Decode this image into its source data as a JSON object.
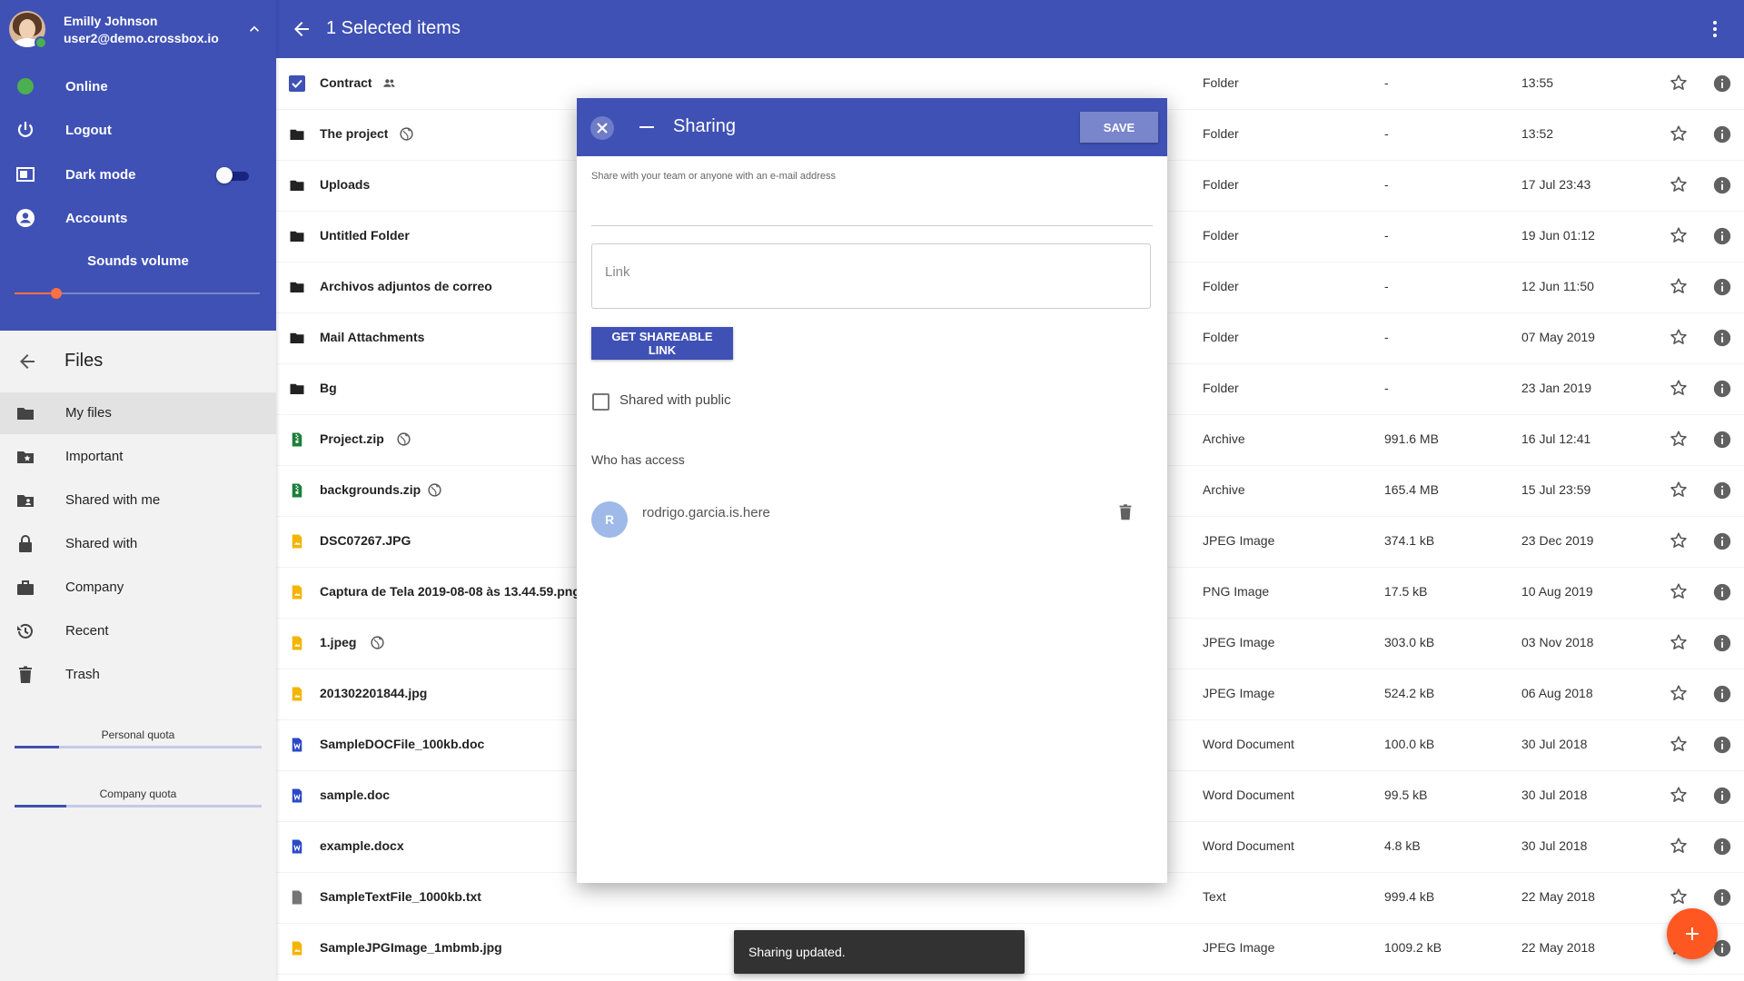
{
  "user": {
    "name": "Emilly Johnson",
    "email": "user2@demo.crossbox.io",
    "status": "Online"
  },
  "sidebar": {
    "menu": [
      {
        "label": "Online",
        "icon": "status-dot-icon"
      },
      {
        "label": "Logout",
        "icon": "power-icon"
      },
      {
        "label": "Dark mode",
        "icon": "dark-mode-icon"
      },
      {
        "label": "Accounts",
        "icon": "account-circle-icon"
      }
    ],
    "dark_mode_on": false,
    "sounds_label": "Sounds volume",
    "sounds_volume": 0.17,
    "files_title": "Files",
    "nav": [
      {
        "label": "My files",
        "icon": "folder-icon",
        "active": true
      },
      {
        "label": "Important",
        "icon": "folder-star-icon",
        "active": false
      },
      {
        "label": "Shared with me",
        "icon": "folder-shared-icon",
        "active": false
      },
      {
        "label": "Shared with",
        "icon": "lock-icon",
        "active": false
      },
      {
        "label": "Company",
        "icon": "briefcase-icon",
        "active": false
      },
      {
        "label": "Recent",
        "icon": "history-icon",
        "active": false
      },
      {
        "label": "Trash",
        "icon": "trash-icon",
        "active": false
      }
    ],
    "quotas": [
      {
        "label": "Personal quota",
        "fraction": 0.18
      },
      {
        "label": "Company quota",
        "fraction": 0.21
      }
    ]
  },
  "topbar": {
    "title": "1 Selected items"
  },
  "files": [
    {
      "name": "Contract",
      "icon": "checkbox-checked-icon",
      "badge": "people-icon",
      "type": "Folder",
      "size": "-",
      "date": "13:55"
    },
    {
      "name": "The project",
      "icon": "folder-icon",
      "badge": "globe-icon",
      "type": "Folder",
      "size": "-",
      "date": "13:52"
    },
    {
      "name": "Uploads",
      "icon": "folder-icon",
      "badge": "",
      "type": "Folder",
      "size": "-",
      "date": "17 Jul 23:43"
    },
    {
      "name": "Untitled Folder",
      "icon": "folder-icon",
      "badge": "",
      "type": "Folder",
      "size": "-",
      "date": "19 Jun 01:12"
    },
    {
      "name": "Archivos adjuntos de correo",
      "icon": "folder-icon",
      "badge": "",
      "type": "Folder",
      "size": "-",
      "date": "12 Jun 11:50"
    },
    {
      "name": "Mail Attachments",
      "icon": "folder-icon",
      "badge": "",
      "type": "Folder",
      "size": "-",
      "date": "07 May 2019"
    },
    {
      "name": "Bg",
      "icon": "folder-icon",
      "badge": "",
      "type": "Folder",
      "size": "-",
      "date": "23 Jan 2019"
    },
    {
      "name": "Project.zip",
      "icon": "archive-icon",
      "badge": "globe-icon",
      "type": "Archive",
      "size": "991.6 MB",
      "date": "16 Jul 12:41"
    },
    {
      "name": "backgrounds.zip",
      "icon": "archive-icon",
      "badge": "globe-icon",
      "type": "Archive",
      "size": "165.4 MB",
      "date": "15 Jul 23:59"
    },
    {
      "name": "DSC07267.JPG",
      "icon": "image-file-icon",
      "badge": "",
      "type": "JPEG Image",
      "size": "374.1 kB",
      "date": "23 Dec 2019"
    },
    {
      "name": "Captura de Tela 2019-08-08 às 13.44.59.png",
      "icon": "image-file-icon",
      "badge": "",
      "type": "PNG Image",
      "size": "17.5 kB",
      "date": "10 Aug 2019"
    },
    {
      "name": "1.jpeg",
      "icon": "image-file-icon",
      "badge": "globe-icon",
      "type": "JPEG Image",
      "size": "303.0 kB",
      "date": "03 Nov 2018"
    },
    {
      "name": "201302201844.jpg",
      "icon": "image-file-icon",
      "badge": "",
      "type": "JPEG Image",
      "size": "524.2 kB",
      "date": "06 Aug 2018"
    },
    {
      "name": "SampleDOCFile_100kb.doc",
      "icon": "word-file-icon",
      "badge": "",
      "type": "Word Document",
      "size": "100.0 kB",
      "date": "30 Jul 2018"
    },
    {
      "name": "sample.doc",
      "icon": "word-file-icon",
      "badge": "",
      "type": "Word Document",
      "size": "99.5 kB",
      "date": "30 Jul 2018"
    },
    {
      "name": "example.docx",
      "icon": "word-file-icon",
      "badge": "",
      "type": "Word Document",
      "size": "4.8 kB",
      "date": "30 Jul 2018"
    },
    {
      "name": "SampleTextFile_1000kb.txt",
      "icon": "text-file-icon",
      "badge": "",
      "type": "Text",
      "size": "999.4 kB",
      "date": "22 May 2018"
    },
    {
      "name": "SampleJPGImage_1mbmb.jpg",
      "icon": "image-file-icon",
      "badge": "",
      "type": "JPEG Image",
      "size": "1009.2 kB",
      "date": "22 May 2018"
    }
  ],
  "dialog": {
    "title": "Sharing",
    "save_label": "SAVE",
    "hint": "Share with your team or anyone with an e-mail address",
    "link_placeholder": "Link",
    "get_link_label": "GET SHAREABLE LINK",
    "public_label": "Shared with public",
    "public_checked": false,
    "access_heading": "Who has access",
    "access_list": [
      {
        "initial": "R",
        "name": "rodrigo.garcia.is.here"
      }
    ]
  },
  "snackbar": {
    "text": "Sharing updated."
  },
  "colors": {
    "primary": "#3f51b5",
    "accent": "#ff5722",
    "online": "#4caf50",
    "folder": "#222222",
    "archive": "#1b7f3b",
    "image": "#f4b400",
    "word": "#2b48c8",
    "text": "#757575"
  }
}
